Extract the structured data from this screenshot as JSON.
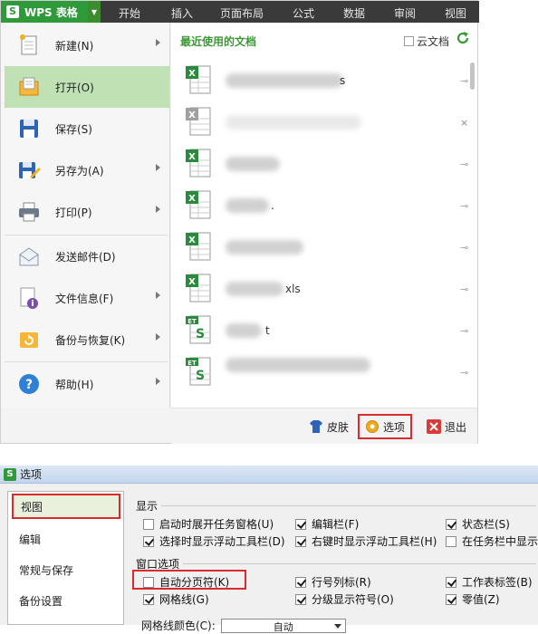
{
  "app": {
    "button_label": "WPS 表格",
    "logo_letter": "S"
  },
  "ribbon_tabs": [
    "开始",
    "插入",
    "页面布局",
    "公式",
    "数据",
    "审阅",
    "视图"
  ],
  "file_menu": {
    "items": [
      {
        "label": "新建(N)",
        "icon": "new-document-icon",
        "has_submenu": true
      },
      {
        "label": "打开(O)",
        "icon": "open-folder-icon",
        "has_submenu": false,
        "active": true
      },
      {
        "label": "保存(S)",
        "icon": "save-icon",
        "has_submenu": false
      },
      {
        "label": "另存为(A)",
        "icon": "save-as-icon",
        "has_submenu": true
      },
      {
        "label": "打印(P)",
        "icon": "printer-icon",
        "has_submenu": true
      },
      {
        "label": "发送邮件(D)",
        "icon": "mail-icon",
        "has_submenu": false
      },
      {
        "label": "文件信息(F)",
        "icon": "file-info-icon",
        "has_submenu": true
      },
      {
        "label": "备份与恢复(K)",
        "icon": "backup-restore-icon",
        "has_submenu": true
      },
      {
        "label": "帮助(H)",
        "icon": "help-icon",
        "has_submenu": true
      }
    ]
  },
  "recent": {
    "title": "最近使用的文档",
    "cloud_label": "云文档",
    "files": [
      {
        "type": "xls",
        "suffix": "s"
      },
      {
        "type": "unknown",
        "suffix": ""
      },
      {
        "type": "xls",
        "suffix": ""
      },
      {
        "type": "xls",
        "suffix": "."
      },
      {
        "type": "xls",
        "suffix": ""
      },
      {
        "type": "xls",
        "suffix": "xls"
      },
      {
        "type": "et",
        "suffix": "t"
      },
      {
        "type": "et",
        "suffix": ""
      }
    ]
  },
  "bottom_bar": {
    "skin_label": "皮肤",
    "options_label": "选项",
    "exit_label": "退出"
  },
  "dialog": {
    "title": "选项",
    "nav": [
      "视图",
      "编辑",
      "常规与保存",
      "备份设置"
    ],
    "display": {
      "title": "显示",
      "options": [
        {
          "label": "启动时展开任务窗格(U)",
          "checked": false
        },
        {
          "label": "编辑栏(F)",
          "checked": true
        },
        {
          "label": "状态栏(S)",
          "checked": true
        },
        {
          "label": "选择时显示浮动工具栏(D)",
          "checked": true
        },
        {
          "label": "右键时显示浮动工具栏(H)",
          "checked": true
        },
        {
          "label": "在任务栏中显示",
          "checked": false
        }
      ]
    },
    "window": {
      "title": "窗口选项",
      "options": [
        {
          "label": "自动分页符(K)",
          "checked": false
        },
        {
          "label": "行号列标(R)",
          "checked": true
        },
        {
          "label": "工作表标签(B)",
          "checked": true
        },
        {
          "label": "网格线(G)",
          "checked": true
        },
        {
          "label": "分级显示符号(O)",
          "checked": true
        },
        {
          "label": "零值(Z)",
          "checked": true
        }
      ]
    },
    "grid_color_label": "网格线颜色(C):",
    "grid_color_value": "自动"
  },
  "colors": {
    "accent_green": "#2f9a3a",
    "highlight_red": "#d92b2b",
    "active_item_bg": "#bfe1b4"
  }
}
